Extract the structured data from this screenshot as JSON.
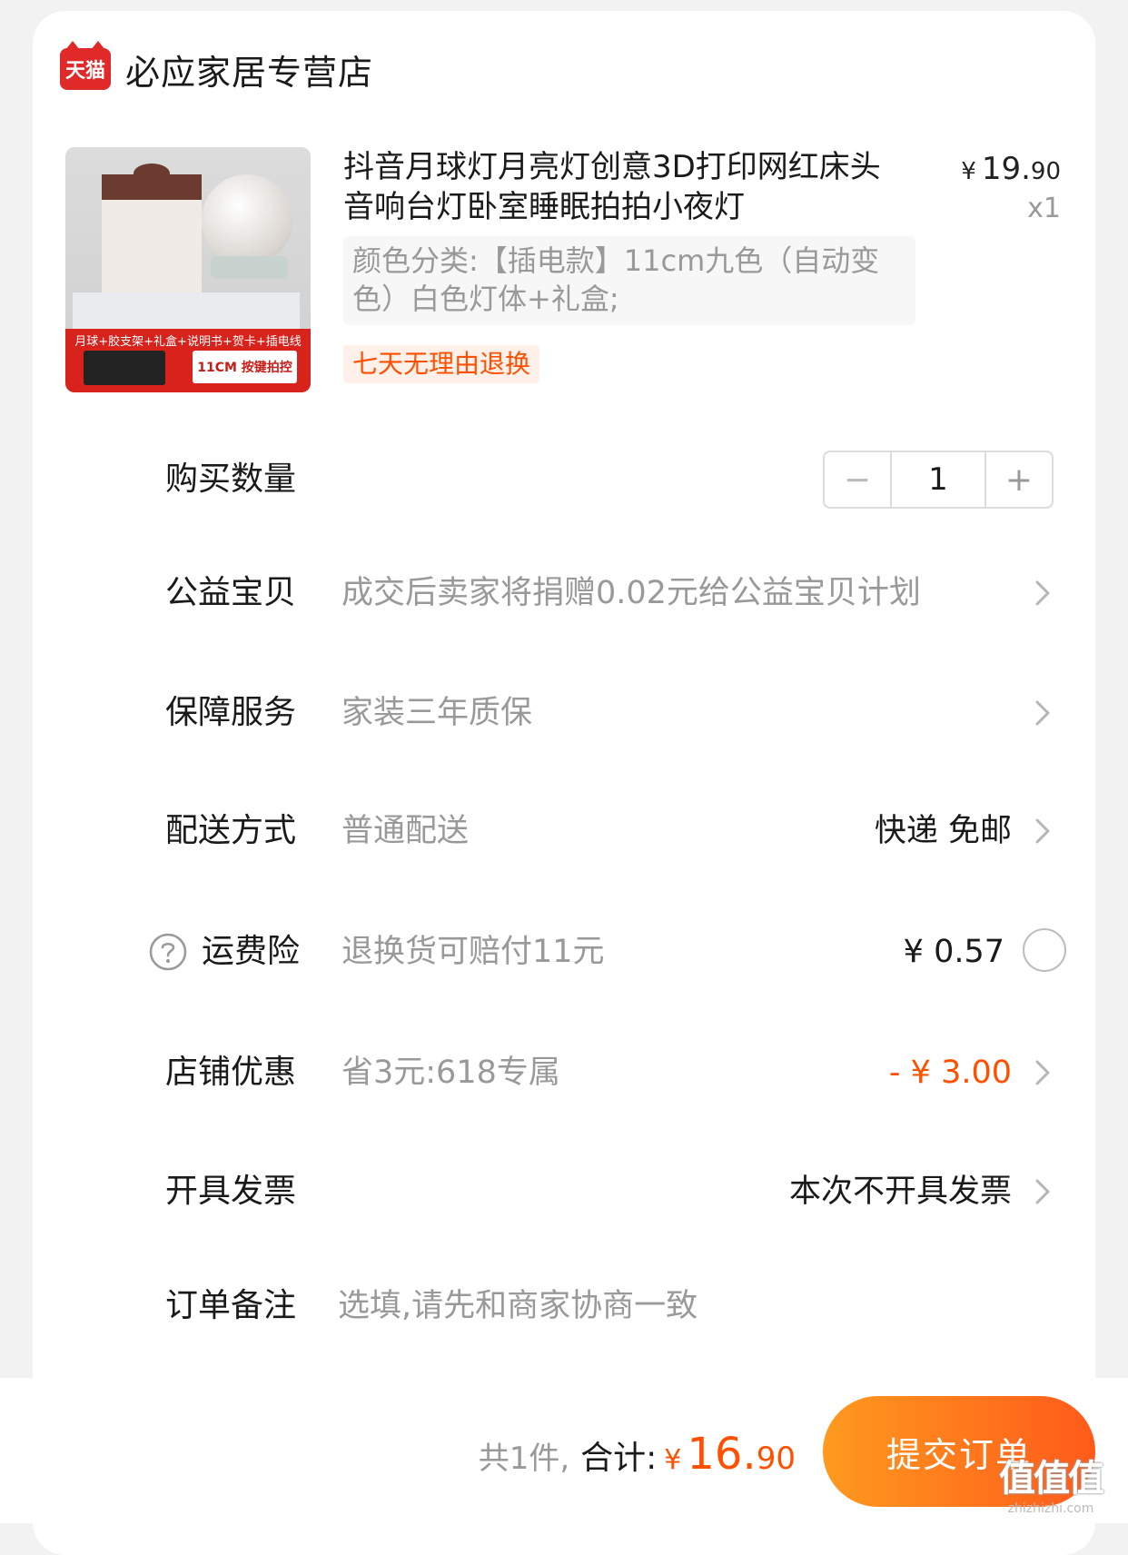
{
  "shop": {
    "logo_text": "天猫",
    "name": "必应家居专营店"
  },
  "product": {
    "title": "抖音月球灯月亮灯创意3D打印网红床头音响台灯卧室睡眠拍拍小夜灯",
    "price_currency": "¥",
    "price_int": "19.",
    "price_dec": "90",
    "quantity_label": "x1",
    "sku": "颜色分类:【插电款】11cm九色（自动变色）白色灯体+礼盒;",
    "return_tag": "七天无理由退换",
    "image_banner_text": "月球+胶支架+礼盒+说明书+贺卡+插电线",
    "image_badge_text": "11CM 按键拍控"
  },
  "rows": {
    "quantity": {
      "label": "购买数量",
      "minus": "−",
      "value": "1",
      "plus": "+"
    },
    "charity": {
      "label": "公益宝贝",
      "value": "成交后卖家将捐赠0.02元给公益宝贝计划"
    },
    "service": {
      "label": "保障服务",
      "value": "家装三年质保"
    },
    "delivery": {
      "label": "配送方式",
      "value": "普通配送",
      "right": "快递 免邮"
    },
    "insurance": {
      "label": "运费险",
      "value": "退换货可赔付11元",
      "right": "¥ 0.57"
    },
    "discount": {
      "label": "店铺优惠",
      "value": "省3元:618专属",
      "right": "- ¥ 3.00"
    },
    "invoice": {
      "label": "开具发票",
      "right": "本次不开具发票"
    },
    "note": {
      "label": "订单备注",
      "placeholder": "选填,请先和商家协商一致"
    }
  },
  "footer": {
    "count": "共1件,",
    "total_label": "合计:",
    "currency": "¥",
    "total_int": "16.",
    "total_dec": "90",
    "submit": "提交订单"
  },
  "watermark": {
    "big": "值值值",
    "small": "zhizhizhi.com"
  },
  "colors": {
    "accent": "#ff5000",
    "tmall_red": "#e02a2a",
    "muted": "#999999"
  }
}
